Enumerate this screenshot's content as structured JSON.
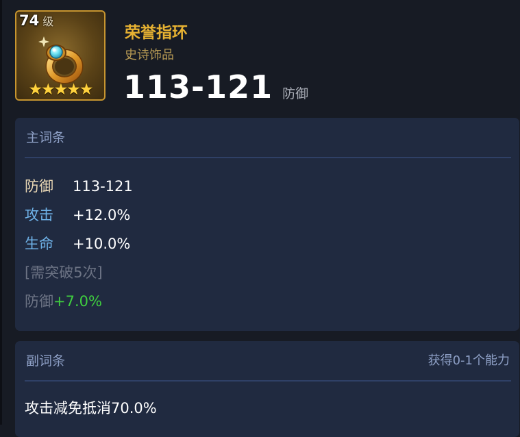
{
  "item": {
    "level_number": "74",
    "level_unit": "级",
    "stars": "★★★★★",
    "name": "荣誉指环",
    "rarity": "史诗饰品",
    "stat_value": "113-121",
    "stat_label": "防御",
    "icon": "ring-icon"
  },
  "main_affixes": {
    "title": "主词条",
    "lines": [
      {
        "label": "防御",
        "value": "113-121"
      },
      {
        "label": "攻击",
        "value": "+12.0%"
      },
      {
        "label": "生命",
        "value": "+10.0%"
      }
    ],
    "locked_requirement": "[需突破5次]",
    "locked_label": "防御",
    "locked_value": "+7.0%"
  },
  "sub_affixes": {
    "title": "副词条",
    "note": "获得0-1个能力",
    "lines": [
      {
        "text": "攻击减免抵消70.0%"
      }
    ]
  },
  "colors": {
    "background": "#171b24",
    "panel": "#202a40",
    "gold_title": "#e6b132",
    "rarity_text": "#b79a54",
    "header_blue": "#8ea0c6",
    "label_blue": "#6fb2e8",
    "locked_gray": "#6c7384",
    "bonus_green": "#3fce3f"
  }
}
